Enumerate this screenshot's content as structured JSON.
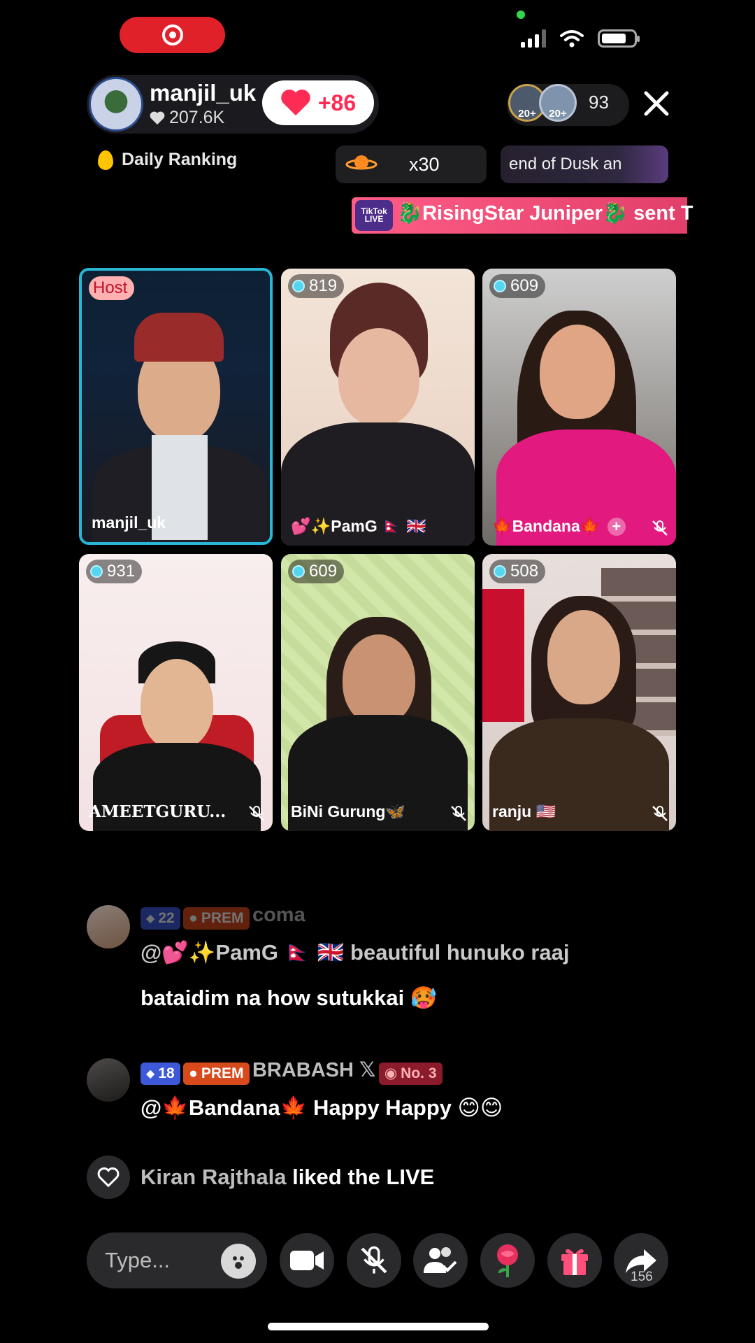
{
  "host": {
    "name": "manjil_uk",
    "likes": "207.6K",
    "heart_count": "+86"
  },
  "viewers": {
    "badge1": "20+",
    "badge2": "20+",
    "count": "93"
  },
  "daily_ranking_label": "Daily Ranking",
  "gift_multiplier": "x30",
  "ticker_text": "end of Dusk an",
  "banner": {
    "badge": "TikTok LIVE",
    "text": "🐉RisingStar Juniper🐉 sent T"
  },
  "participants": [
    {
      "name": "manjil_uk",
      "badge": "Host",
      "muted": false,
      "role": "host"
    },
    {
      "name": "💕✨PamG 🇳🇵 🇬🇧",
      "score": "819",
      "muted": false
    },
    {
      "name": "🍁Bandana🍁",
      "score": "609",
      "muted": true,
      "plus": "+"
    },
    {
      "name": "AMEETGURU...",
      "score": "931",
      "muted": true
    },
    {
      "name": "BiNi Gurung🦋",
      "score": "609",
      "muted": true
    },
    {
      "name": "ranju 🇺🇸",
      "score": "508",
      "muted": true
    }
  ],
  "comments": [
    {
      "level": "22",
      "badge": "PREM",
      "user": "coma",
      "text1": "@💕✨PamG 🇳🇵 🇬🇧 beautiful hunuko raaj",
      "text2": "bataidim na how sutukkai 🥵"
    },
    {
      "level": "18",
      "badge": "PREM",
      "user": "BRABASH 𝕏",
      "rank": "No. 3",
      "text": "@🍁Bandana🍁 Happy Happy 😊😊"
    }
  ],
  "like_event": {
    "user": "Kiran Rajthala",
    "text": "liked the LIVE"
  },
  "bottom_bar": {
    "placeholder": "Type...",
    "share_count": "156"
  },
  "colors": {
    "accent": "#fe2c55",
    "host_border": "#27b6d6",
    "record": "#e0212a"
  },
  "icons": [
    "record-icon",
    "signal-icon",
    "wifi-icon",
    "battery-icon",
    "heart-icon",
    "close-icon",
    "planet-icon",
    "gem-icon",
    "mic-off-icon",
    "emoji-icon",
    "camera-icon",
    "guests-icon",
    "rose-icon",
    "gift-icon",
    "share-icon"
  ]
}
